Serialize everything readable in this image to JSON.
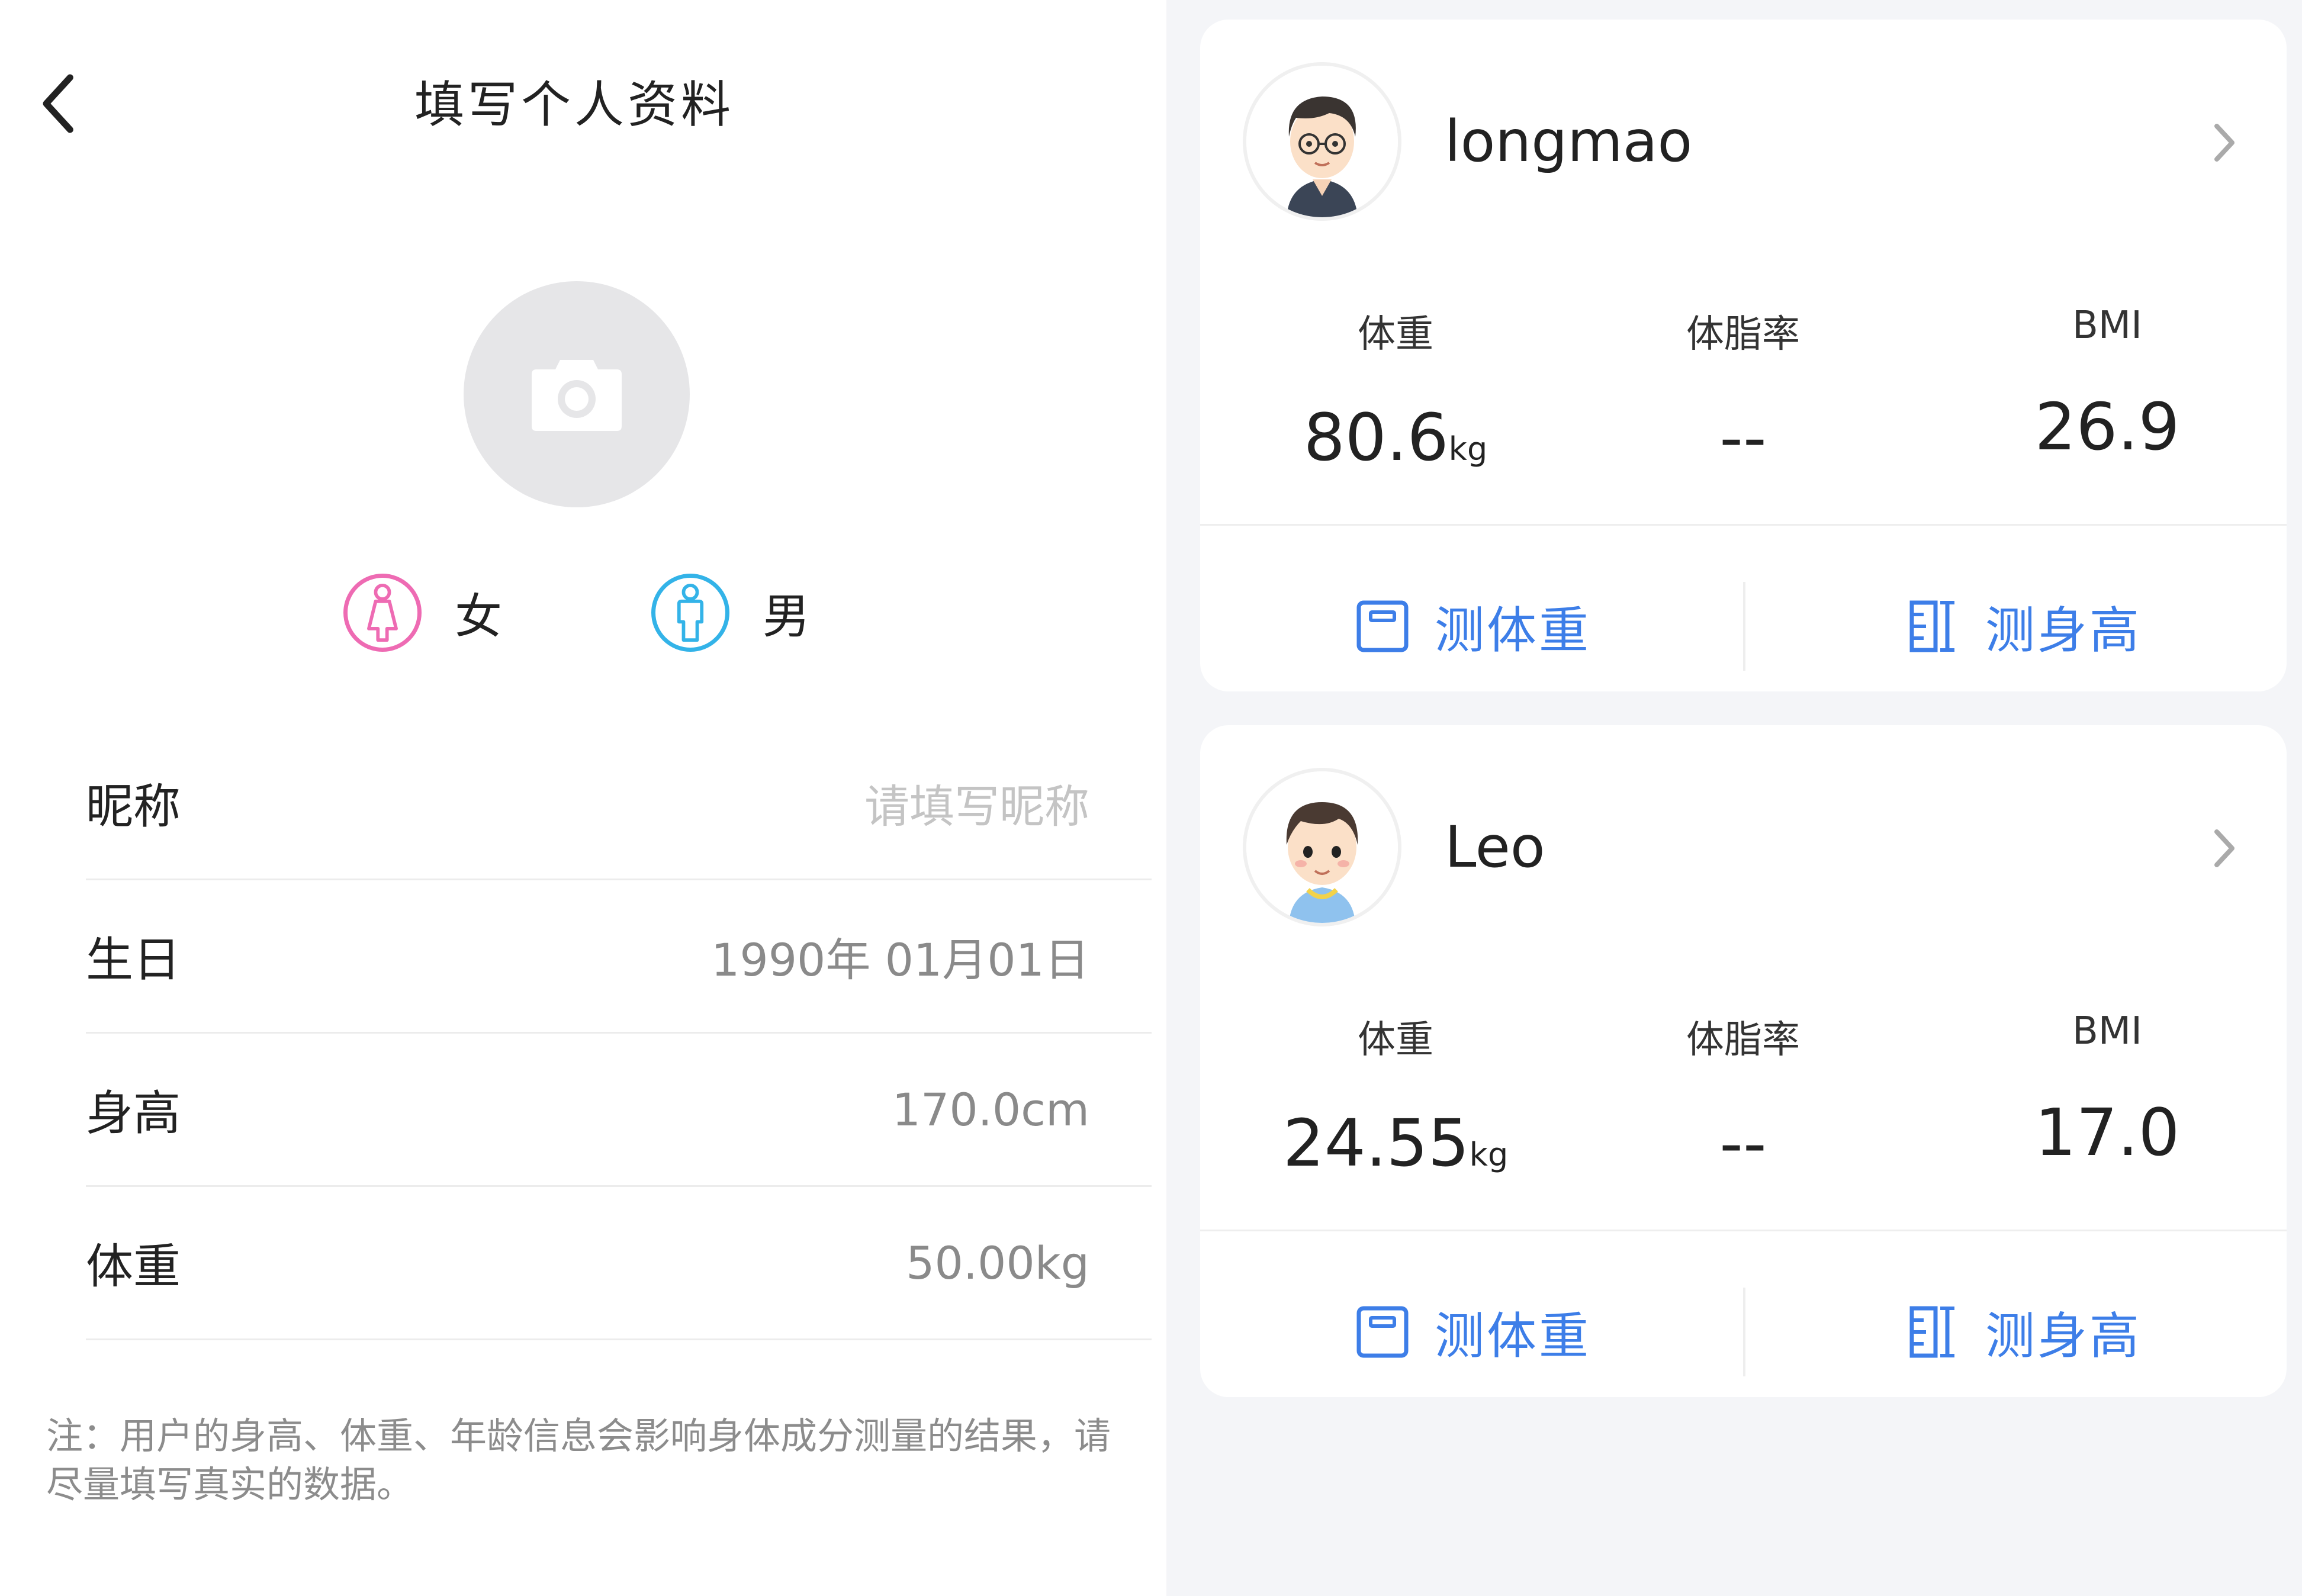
{
  "profile_form": {
    "nav_title": "填写个人资料",
    "gender": {
      "female_label": "女",
      "male_label": "男",
      "female_color": "#ee6bb3",
      "male_color": "#33b3e8"
    },
    "fields": [
      {
        "label": "昵称",
        "value": "请填写昵称",
        "is_placeholder": true
      },
      {
        "label": "生日",
        "value": "1990年 01月01日",
        "is_placeholder": false
      },
      {
        "label": "身高",
        "value": "170.0cm",
        "is_placeholder": false
      },
      {
        "label": "体重",
        "value": "50.00kg",
        "is_placeholder": false
      }
    ],
    "note": "注：用户的身高、体重、年龄信息会影响身体成分测量的结果，请尽量填写真实的数据。"
  },
  "users": [
    {
      "name": "longmao",
      "stats": {
        "weight_label": "体重",
        "weight_value": "80.6",
        "weight_unit": "kg",
        "fat_label": "体脂率",
        "fat_value": "--",
        "bmi_label": "BMI",
        "bmi_value": "26.9"
      },
      "actions": {
        "measure_weight": "测体重",
        "measure_height": "测身高"
      }
    },
    {
      "name": "Leo",
      "stats": {
        "weight_label": "体重",
        "weight_value": "24.55",
        "weight_unit": "kg",
        "fat_label": "体脂率",
        "fat_value": "--",
        "bmi_label": "BMI",
        "bmi_value": "17.0"
      },
      "actions": {
        "measure_weight": "测体重",
        "measure_height": "测身高"
      }
    }
  ],
  "colors": {
    "accent": "#3d7ee8",
    "panel_bg": "#f4f5f8"
  },
  "icons": [
    "back-arrow-icon",
    "camera-icon",
    "female-icon",
    "male-icon",
    "chevron-right-icon",
    "scale-icon",
    "ruler-icon"
  ]
}
